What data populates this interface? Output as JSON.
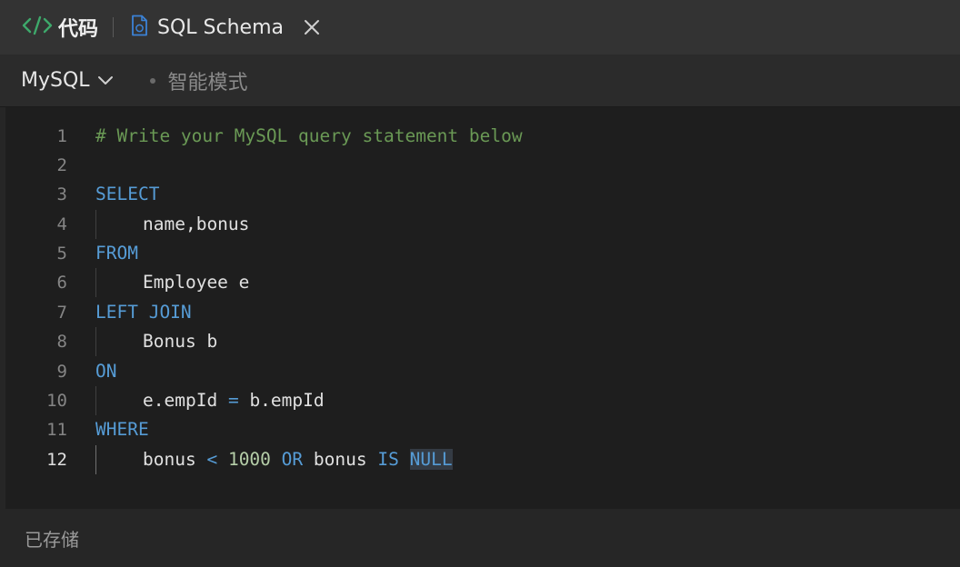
{
  "tabs": {
    "code_label": "代码",
    "schema_label": "SQL Schema"
  },
  "toolbar": {
    "language": "MySQL",
    "smart_mode_label": "智能模式"
  },
  "editor": {
    "lines": [
      {
        "n": "1",
        "comment": "# Write your MySQL query statement below"
      },
      {
        "n": "2"
      },
      {
        "n": "3",
        "kw": "SELECT"
      },
      {
        "n": "4",
        "text": "name,bonus"
      },
      {
        "n": "5",
        "kw": "FROM"
      },
      {
        "n": "6",
        "text": "Employee e"
      },
      {
        "n": "7",
        "kw": "LEFT JOIN"
      },
      {
        "n": "8",
        "text": "Bonus b"
      },
      {
        "n": "9",
        "kw": "ON"
      },
      {
        "n": "10",
        "t1": "e.empId",
        "op": "=",
        "t2": "b.empId"
      },
      {
        "n": "11",
        "kw": "WHERE"
      },
      {
        "n": "12",
        "t1": "bonus",
        "op": "<",
        "num": "1000",
        "kw1": "OR",
        "t2": "bonus",
        "kw2": "IS",
        "kw3": "NULL"
      }
    ]
  },
  "status": {
    "label": "已存储"
  },
  "colors": {
    "keyword": "#569cd6",
    "comment": "#6a9955",
    "number": "#b5cea8",
    "accent_green": "#3ea86b"
  },
  "icons": [
    "code-brackets-icon",
    "file-sql-icon",
    "close-icon",
    "chevron-down-icon"
  ]
}
